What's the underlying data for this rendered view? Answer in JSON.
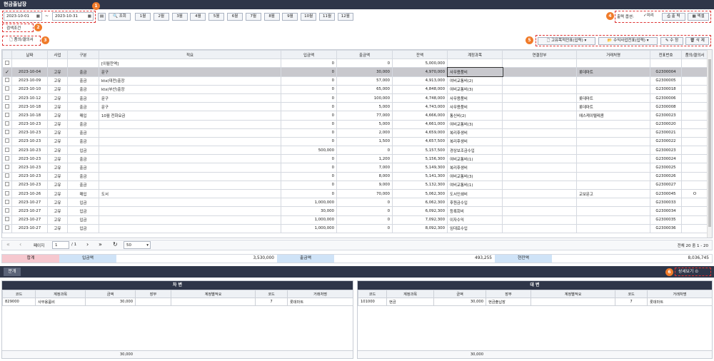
{
  "window": {
    "title": "현금출납장"
  },
  "search": {
    "date_from": "2023-10-01",
    "date_sep": "~",
    "date_to": "2023-10-31",
    "query_label": "조회",
    "months": [
      "1월",
      "2월",
      "3월",
      "4월",
      "5월",
      "6월",
      "7월",
      "8월",
      "9월",
      "10월",
      "11월",
      "12월"
    ],
    "condition_label": "검색조건"
  },
  "toolbar": {
    "print_option_label": "출력 옵션:",
    "preview_label": "미리",
    "print_label": "출 력",
    "excel_label": "엑셀",
    "approval_label": "품의/결의서",
    "voucher1_label": "고유목적전표(입력)",
    "voucher2_label": "수익사업전표(입력)",
    "edit_label": "수 정",
    "delete_label": "삭 제"
  },
  "badges": [
    "1",
    "2",
    "3",
    "4",
    "5",
    "6"
  ],
  "grid": {
    "headers": [
      "날짜",
      "사업",
      "구분",
      "적요",
      "입금액",
      "출금액",
      "잔액",
      "계정과목",
      "연결장부",
      "거래처명",
      "전표번호",
      "품의/결의서"
    ],
    "rows": [
      [
        "",
        "",
        "",
        "[이월잔액]",
        "0",
        "0",
        "5,000,000",
        "",
        "",
        "",
        "",
        ""
      ],
      [
        "2023-10-04",
        "고유",
        "출금",
        "문구",
        "0",
        "30,000",
        "4,970,000",
        "사무용품비",
        "",
        "롯데마트",
        "G2300004",
        ""
      ],
      [
        "2023-10-09",
        "고유",
        "출금",
        "ktx(대전)출장",
        "0",
        "57,000",
        "4,913,000",
        "여비교통비(2)",
        "",
        "",
        "G2300005",
        ""
      ],
      [
        "2023-10-10",
        "고유",
        "출금",
        "ktx(부산)출장",
        "0",
        "65,000",
        "4,848,000",
        "여비교통비(3)",
        "",
        "",
        "G2300018",
        ""
      ],
      [
        "2023-10-12",
        "고유",
        "출금",
        "문구",
        "0",
        "100,000",
        "4,748,000",
        "사무용품비",
        "",
        "롯데마트",
        "G2300006",
        ""
      ],
      [
        "2023-10-18",
        "고유",
        "출금",
        "문구",
        "0",
        "5,000",
        "4,743,000",
        "사무용품비",
        "",
        "롯데마트",
        "G2300008",
        ""
      ],
      [
        "2023-10-18",
        "고유",
        "매입",
        "10월 전화요금",
        "0",
        "77,000",
        "4,666,000",
        "통신비(2)",
        "",
        "에스케이텔레콤",
        "G2300023",
        ""
      ],
      [
        "2023-10-23",
        "고유",
        "출금",
        "",
        "0",
        "5,000",
        "4,661,000",
        "여비교통비(3)",
        "",
        "",
        "G2300020",
        ""
      ],
      [
        "2023-10-23",
        "고유",
        "출금",
        "",
        "0",
        "2,000",
        "4,659,000",
        "복리후생비",
        "",
        "",
        "G2300021",
        ""
      ],
      [
        "2023-10-23",
        "고유",
        "출금",
        "",
        "0",
        "1,500",
        "4,657,500",
        "복리후생비",
        "",
        "",
        "G2300022",
        ""
      ],
      [
        "2023-10-23",
        "고유",
        "입금",
        "",
        "500,000",
        "0",
        "5,157,500",
        "경상보조금수입",
        "",
        "",
        "G2300023",
        ""
      ],
      [
        "2023-10-23",
        "고유",
        "출금",
        "",
        "0",
        "1,200",
        "5,156,300",
        "여비교통비(1)",
        "",
        "",
        "G2300024",
        ""
      ],
      [
        "2023-10-23",
        "고유",
        "출금",
        "",
        "0",
        "7,000",
        "5,149,300",
        "복리후생비",
        "",
        "",
        "G2300025",
        ""
      ],
      [
        "2023-10-23",
        "고유",
        "출금",
        "",
        "0",
        "8,000",
        "5,141,300",
        "여비교통비(3)",
        "",
        "",
        "G2300026",
        ""
      ],
      [
        "2023-10-23",
        "고유",
        "출금",
        "",
        "0",
        "9,000",
        "5,132,300",
        "여비교통비(1)",
        "",
        "",
        "G2300027",
        ""
      ],
      [
        "2023-10-26",
        "고유",
        "매입",
        "도서",
        "0",
        "70,000",
        "5,062,300",
        "도서인쇄비",
        "",
        "교보문고",
        "G2300045",
        "O"
      ],
      [
        "2023-10-27",
        "고유",
        "입금",
        "",
        "1,000,000",
        "0",
        "6,062,300",
        "후원금수입",
        "",
        "",
        "G2300033",
        ""
      ],
      [
        "2023-10-27",
        "고유",
        "입금",
        "",
        "30,000",
        "0",
        "6,092,300",
        "등록회비",
        "",
        "",
        "G2300034",
        ""
      ],
      [
        "2023-10-27",
        "고유",
        "입금",
        "",
        "1,000,000",
        "0",
        "7,092,300",
        "이자수익",
        "",
        "",
        "G2300035",
        ""
      ],
      [
        "2023-10-27",
        "고유",
        "입금",
        "",
        "1,000,000",
        "0",
        "8,092,300",
        "임대료수입",
        "",
        "",
        "G2300036",
        ""
      ]
    ]
  },
  "pager": {
    "page_label": "페이지",
    "page_value": "1",
    "page_total": "/ 1",
    "page_size": "50",
    "summary": "전체 20 중 1 - 20"
  },
  "totals": {
    "sum_label": "합계",
    "in_label": "입금액",
    "in_value": "3,530,000",
    "out_label": "출금액",
    "out_value": "493,255",
    "bal_label": "현잔액",
    "bal_value": "8,036,745"
  },
  "split": {
    "tab_label": "분개",
    "detail_label": "상세보기"
  },
  "debit": {
    "title": "차 변",
    "headers": [
      "코드",
      "계정과목",
      "금액",
      "장부",
      "계정별적요",
      "코드",
      "거래처명"
    ],
    "rows": [
      [
        "829000",
        "사무용품비",
        "30,000",
        "",
        "",
        "7",
        "롯데마트"
      ]
    ],
    "total": "30,000"
  },
  "credit": {
    "title": "대 변",
    "headers": [
      "코드",
      "계정과목",
      "금액",
      "장부",
      "계정별적요",
      "코드",
      "거래처명"
    ],
    "rows": [
      [
        "101000",
        "현금",
        "30,000",
        "현금출납장",
        "",
        "7",
        "롯데마트"
      ]
    ],
    "total": "30,000"
  }
}
